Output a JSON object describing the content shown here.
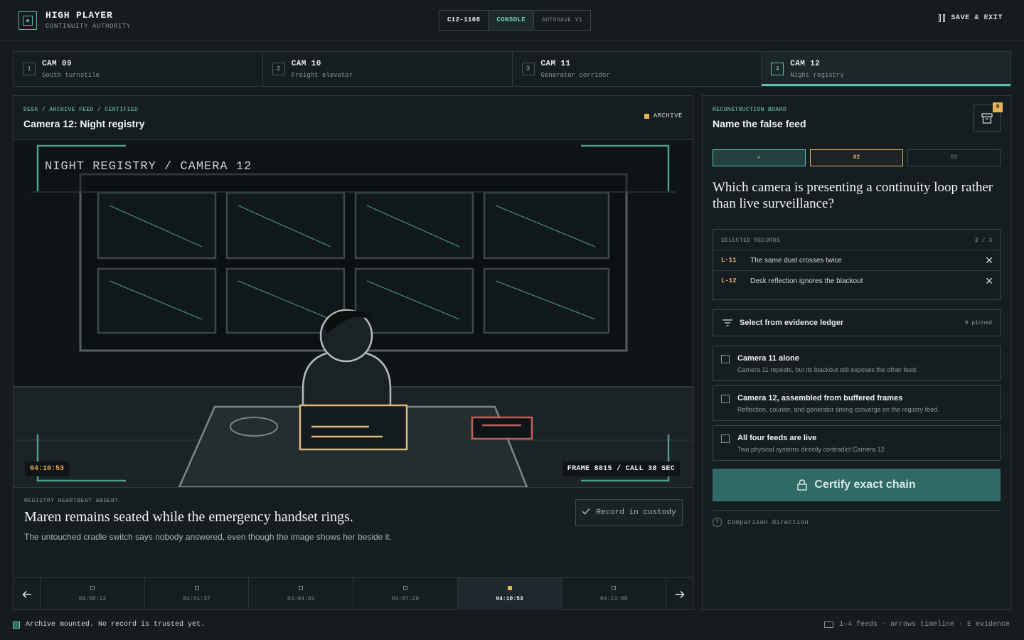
{
  "app": {
    "title": "HIGH PLAYER",
    "subtitle": "CONTINUITY AUTHORITY",
    "case_id": "C12-1108",
    "mode": "CONSOLE",
    "autosave": "AUTOSAVE V1",
    "save_exit": "SAVE & EXIT"
  },
  "tabs": [
    {
      "num": "1",
      "title": "CAM 09",
      "sub": "South turnstile"
    },
    {
      "num": "2",
      "title": "CAM 10",
      "sub": "Freight elevator"
    },
    {
      "num": "3",
      "title": "CAM 11",
      "sub": "Generator corridor"
    },
    {
      "num": "4",
      "title": "CAM 12",
      "sub": "Night registry",
      "active": true
    }
  ],
  "feed": {
    "breadcrumb": "DESK / ARCHIVE FEED / CERTIFIED",
    "title": "Camera 12: Night registry",
    "badge": "ARCHIVE",
    "overlay_label": "NIGHT REGISTRY / CAMERA 12",
    "timestamp": "04:10:53",
    "frame_info": "FRAME 8815 / CALL 38 SEC",
    "caption_kicker": "REGISTRY HEARTBEAT ABSENT.",
    "caption_title": "Maren remains seated while the emergency handset rings.",
    "caption_body": "The untouched cradle switch says nobody answered, even though the image shows her beside it.",
    "record_button": "Record in custody"
  },
  "timeline": [
    {
      "time": "03:58:12"
    },
    {
      "time": "04:01:37"
    },
    {
      "time": "04:04:02"
    },
    {
      "time": "04:07:29"
    },
    {
      "time": "04:10:53",
      "active": true
    },
    {
      "time": "04:13:00"
    }
  ],
  "board": {
    "kicker": "RECONSTRUCTION BOARD",
    "title": "Name the false feed",
    "evidence_count": "9",
    "steps": [
      "✓",
      "02",
      "03"
    ],
    "question": "Which camera is presenting a continuity loop rather than live surveillance?",
    "records_header": "SELECTED RECORDS",
    "records_count": "2 / 3",
    "records": [
      {
        "id": "L-11",
        "text": "The same dust crosses twice"
      },
      {
        "id": "L-12",
        "text": "Desk reflection ignores the blackout"
      }
    ],
    "ledger_label": "Select from evidence ledger",
    "ledger_pinned": "9 pinned",
    "options": [
      {
        "title": "Camera 11 alone",
        "sub": "Camera 11 repeats, but its blackout still exposes the other feed."
      },
      {
        "title": "Camera 12, assembled from buffered frames",
        "sub": "Reflection, counter, and generator timing converge on the registry feed."
      },
      {
        "title": "All four feeds are live",
        "sub": "Two physical systems directly contradict Camera 12."
      }
    ],
    "certify_label": "Certify exact chain",
    "compare_label": "Comparison direction"
  },
  "footer": {
    "status": "Archive mounted. No record is trusted yet.",
    "keys": "1–4 feeds · arrows timeline · E evidence"
  },
  "colors": {
    "accent": "#5fc3b3",
    "warning": "#e3b25a",
    "danger": "#c0605a",
    "background": "#151b1e"
  }
}
